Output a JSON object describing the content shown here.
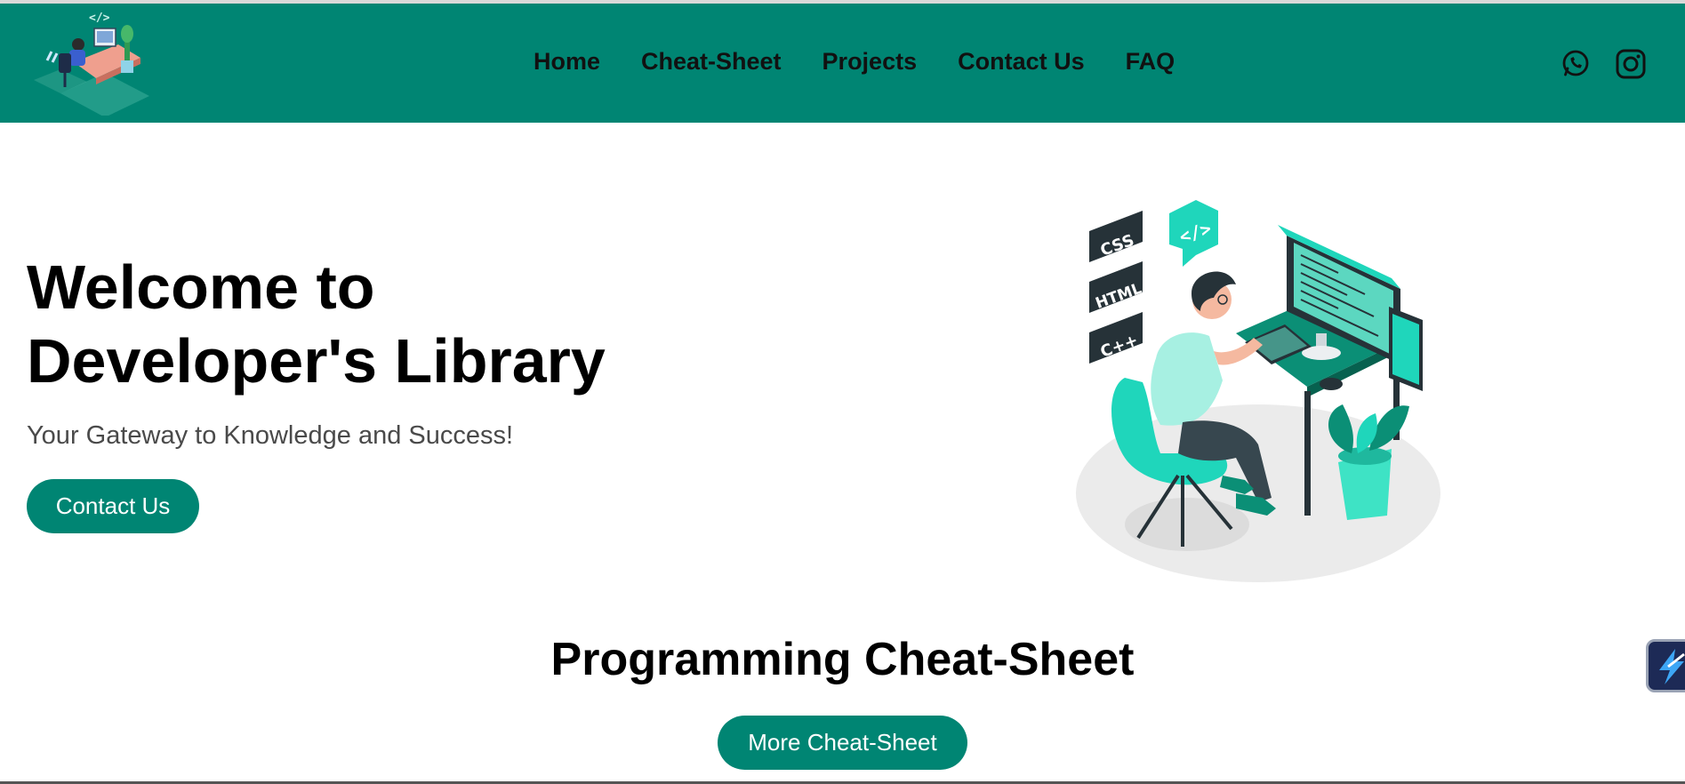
{
  "nav": {
    "links": [
      "Home",
      "Cheat-Sheet",
      "Projects",
      "Contact Us",
      "FAQ"
    ],
    "social_icons": [
      "whatsapp-icon",
      "instagram-icon"
    ]
  },
  "hero": {
    "title_line1": "Welcome to",
    "title_line2": "Developer's Library",
    "subtitle": "Your Gateway to Knowledge and Success!",
    "cta_label": "Contact Us",
    "illustration_tags": [
      "CSS",
      "HTML",
      "C++"
    ]
  },
  "cheatsheet": {
    "title": "Programming Cheat-Sheet",
    "button_label": "More Cheat-Sheet"
  },
  "colors": {
    "brand": "#008573",
    "accent_light": "#1fd6bb",
    "dark": "#263238"
  }
}
